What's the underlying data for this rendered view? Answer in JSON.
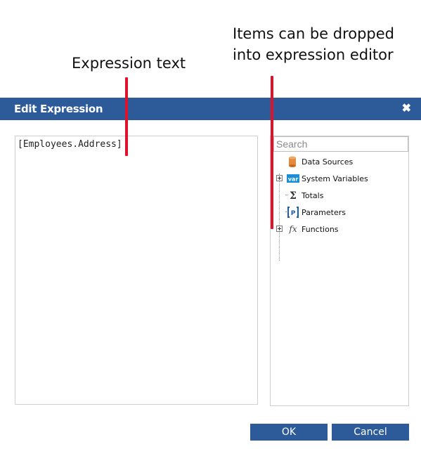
{
  "annotations": {
    "expression_text": "Expression text",
    "drop_note_line1": "Items can be dropped",
    "drop_note_line2": "into expression editor",
    "line_color": "#e0122b"
  },
  "dialog": {
    "title": "Edit Expression",
    "close_icon": "close-icon",
    "header_color": "#2d5b9a"
  },
  "editor": {
    "text": "[Employees.Address]"
  },
  "tree": {
    "search_placeholder": "Search",
    "items": [
      {
        "label": "Data Sources",
        "icon": "database-icon",
        "expandable": false
      },
      {
        "label": "System Variables",
        "icon": "var-icon",
        "expandable": true
      },
      {
        "label": "Totals",
        "icon": "sigma-icon",
        "expandable": false
      },
      {
        "label": "Parameters",
        "icon": "parameters-icon",
        "expandable": false
      },
      {
        "label": "Functions",
        "icon": "fx-icon",
        "expandable": true
      }
    ]
  },
  "buttons": {
    "ok": "OK",
    "cancel": "Cancel"
  }
}
